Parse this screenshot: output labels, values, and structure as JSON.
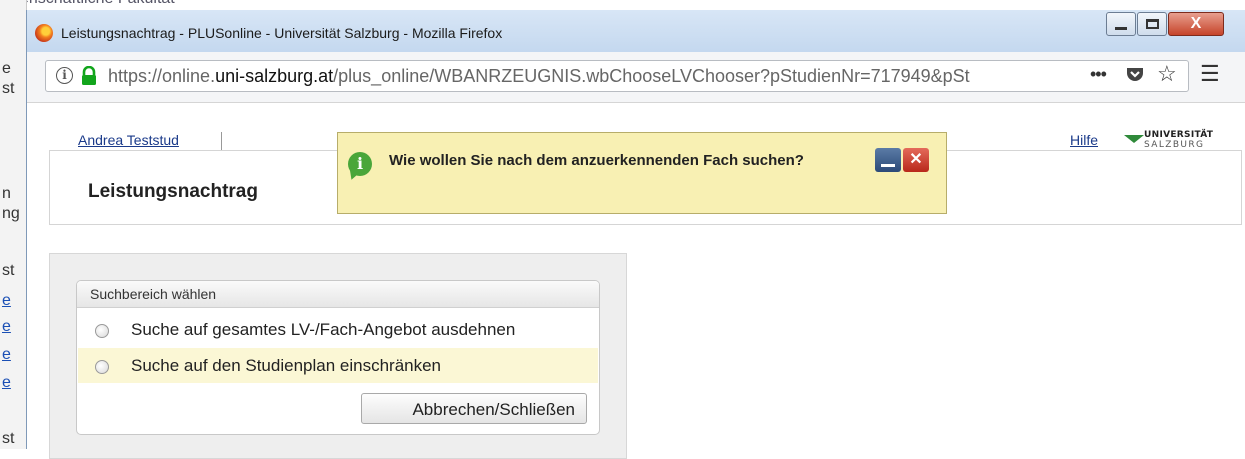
{
  "background_window": {
    "top_text": "senschaftliche Fakultät",
    "side_fragments": [
      "e",
      "st",
      "n",
      "ng",
      "st",
      "e",
      "e",
      "e",
      "e",
      "st"
    ]
  },
  "window": {
    "title": "Leistungsnachtrag - PLUSonline - Universität Salzburg - Mozilla Firefox",
    "close_glyph": "X"
  },
  "urlbar": {
    "url_prefix": "https://online.",
    "url_domain": "uni-salzburg.at",
    "url_path": "/plus_online/WBANRZEUGNIS.wbChooseLVChooser?pStudienNr=717949&pSt",
    "more_glyph": "•••",
    "star_glyph": "☆",
    "menu_glyph": "☰",
    "info_glyph": "i"
  },
  "page": {
    "user_name": "Andrea Teststud",
    "title": "Leistungsnachtrag",
    "help_link": "Hilfe",
    "logo": {
      "line1": "UNIVERSITÄT",
      "line2": "SALZBURG"
    }
  },
  "hint": {
    "icon_glyph": "i",
    "text": "Wie wollen Sie nach dem anzuerkennenden Fach suchen?",
    "close_glyph": "✕"
  },
  "search": {
    "box_title": "Suchbereich wählen",
    "options": [
      {
        "label": "Suche auf gesamtes LV-/Fach-Angebot ausdehnen",
        "selected": false
      },
      {
        "label": "Suche auf den Studienplan einschränken",
        "selected": false
      }
    ],
    "cancel_label": "Abbrechen/Schließen"
  }
}
